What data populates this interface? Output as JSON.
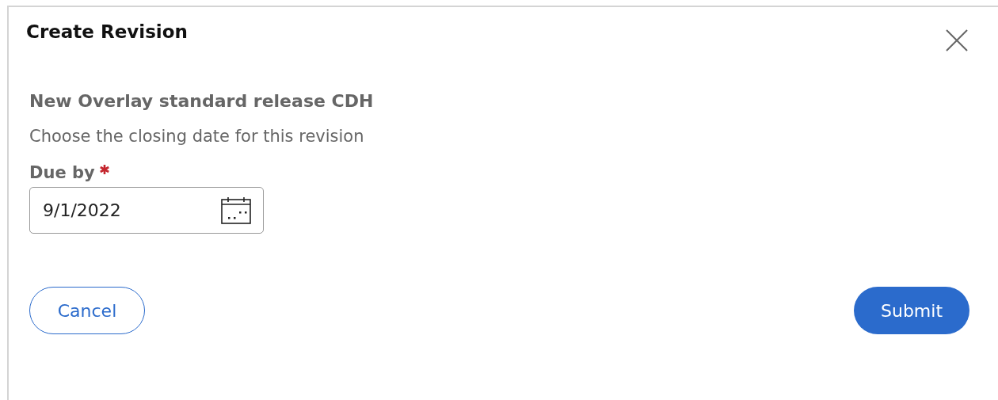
{
  "dialog": {
    "title": "Create Revision"
  },
  "heading": "New Overlay standard release CDH",
  "description": "Choose the closing date for this revision",
  "field": {
    "label": "Due by",
    "required": true,
    "value": "9/1/2022"
  },
  "buttons": [
    {
      "label": "Cancel",
      "kind": "secondary"
    },
    {
      "label": "Submit",
      "kind": "primary"
    }
  ]
}
